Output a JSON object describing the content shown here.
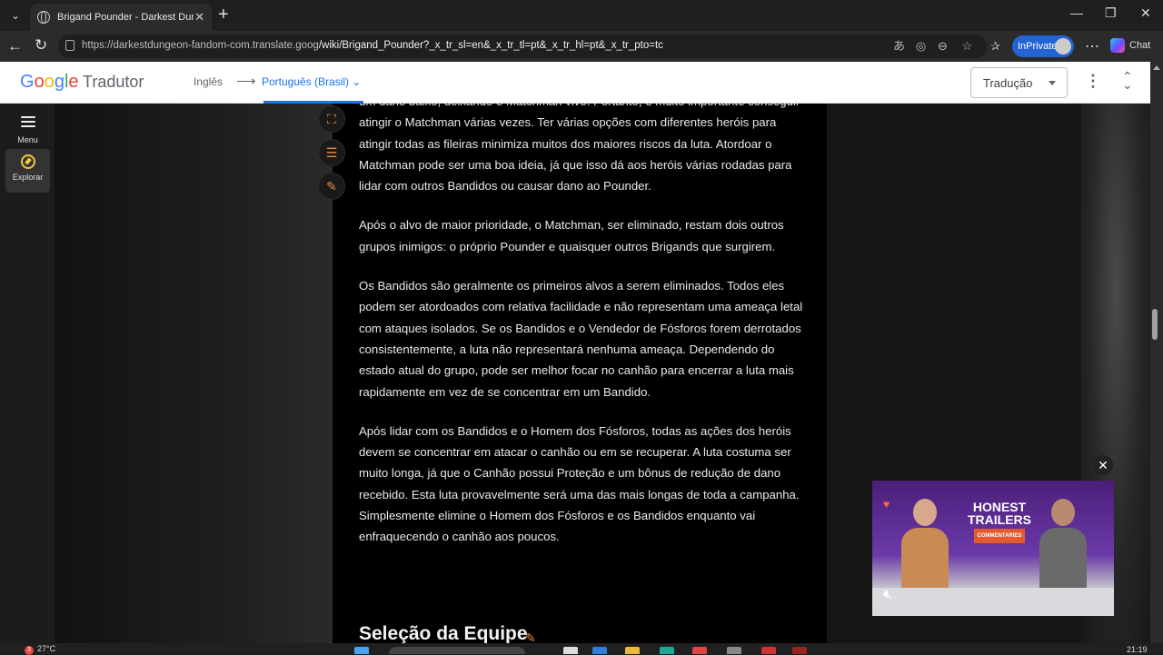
{
  "browser": {
    "tab_title": "Brigand Pounder - Darkest Dungeon",
    "tab_close": "✕",
    "new_tab": "+",
    "url_host": "https://darkestdungeon-fandom-com.translate.goog",
    "url_path": "/wiki/Brigand_Pounder?_x_tr_sl=en&_x_tr_tl=pt&_x_tr_hl=pt&_x_tr_pto=tc",
    "inprivate_label": "InPrivate",
    "chat_label": "Chat"
  },
  "translate_bar": {
    "logo": [
      "G",
      "o",
      "o",
      "g",
      "l",
      "e"
    ],
    "logo_colors": [
      "#4285F4",
      "#EA4335",
      "#FBBC05",
      "#4285F4",
      "#34A853",
      "#EA4335"
    ],
    "product": "Tradutor",
    "source_lang": "Inglês",
    "arrow": "⟶",
    "target_lang": "Português (Brasil) ⌄",
    "mode": "Tradução"
  },
  "sidebar": {
    "menu_label": "Menu",
    "explore_label": "Explorar"
  },
  "article": {
    "paragraphs": [
      "um dano baixo, deixando o Matchman vivo. Portanto, é muito importante conseguir atingir o Matchman várias vezes. Ter várias opções com diferentes heróis para atingir todas as fileiras minimiza muitos dos maiores riscos da luta. Atordoar o Matchman pode ser uma boa ideia, já que isso dá aos heróis várias rodadas para lidar com outros Bandidos ou causar dano ao Pounder.",
      "Após o alvo de maior prioridade, o Matchman, ser eliminado, restam dois outros grupos inimigos: o próprio Pounder e quaisquer outros Brigands que surgirem.",
      "Os Bandidos são geralmente os primeiros alvos a serem eliminados. Todos eles podem ser atordoados com relativa facilidade e não representam uma ameaça letal com ataques isolados. Se os Bandidos e o Vendedor de Fósforos forem derrotados consistentemente, a luta não representará nenhuma ameaça. Dependendo do estado atual do grupo, pode ser melhor focar no canhão para encerrar a luta mais rapidamente em vez de se concentrar em um Bandido.",
      "Após lidar com os Bandidos e o Homem dos Fósforos, todas as ações dos heróis devem se concentrar em atacar o canhão ou em se recuperar. A luta costuma ser muito longa, já que o Canhão possui Proteção e um bônus de redução de dano recebido. Esta luta provavelmente será uma das mais longas de toda a campanha. Simplesmente elimine o Homem dos Fósforos e os Bandidos enquanto vai enfraquecendo o canhão aos poucos."
    ],
    "section_heading": "Seleção da Equipe"
  },
  "video": {
    "title_line1": "HONEST",
    "title_line2": "TRAILERS",
    "subtitle": "COMMENTARIES"
  },
  "taskbar": {
    "weather_badge": "3",
    "temperature": "27°C",
    "time": "21:19"
  }
}
